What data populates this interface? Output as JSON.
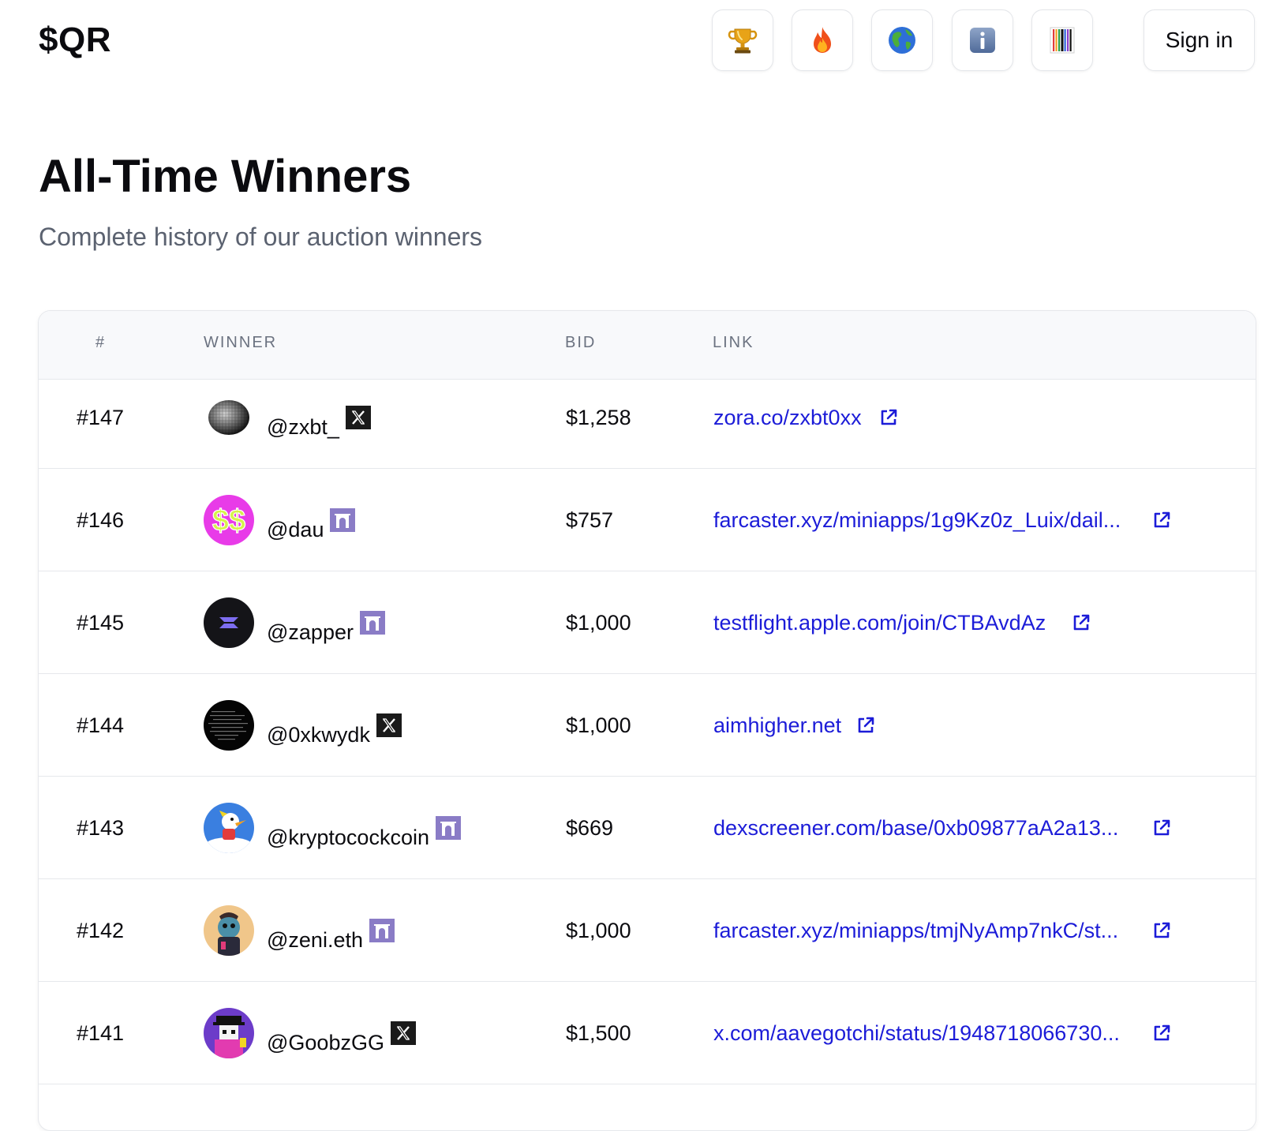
{
  "header": {
    "logo": "$QR",
    "nav_buttons": [
      {
        "name": "trophy-icon",
        "glyph": "🏆"
      },
      {
        "name": "fire-icon",
        "glyph": "🔥"
      },
      {
        "name": "globe-icon",
        "glyph": "🌎"
      },
      {
        "name": "info-icon",
        "glyph": "ℹ"
      },
      {
        "name": "barcode-icon",
        "glyph": "barcode"
      }
    ],
    "signin_label": "Sign in"
  },
  "page": {
    "title": "All-Time Winners",
    "subtitle": "Complete history of our auction winners"
  },
  "table": {
    "columns": [
      "#",
      "WINNER",
      "BID",
      "LINK"
    ],
    "rows": [
      {
        "rank": "#147",
        "winner": "@zxbt_",
        "platform": "x",
        "bid": "$1,258",
        "link": "zora.co/zxbt0xx"
      },
      {
        "rank": "#146",
        "winner": "@dau",
        "platform": "farcaster",
        "bid": "$757",
        "link": "farcaster.xyz/miniapps/1g9Kz0z_Luix/dail..."
      },
      {
        "rank": "#145",
        "winner": "@zapper",
        "platform": "farcaster",
        "bid": "$1,000",
        "link": "testflight.apple.com/join/CTBAvdAz"
      },
      {
        "rank": "#144",
        "winner": "@0xkwydk",
        "platform": "x",
        "bid": "$1,000",
        "link": "aimhigher.net"
      },
      {
        "rank": "#143",
        "winner": "@kryptocockcoin",
        "platform": "farcaster",
        "bid": "$669",
        "link": "dexscreener.com/base/0xb09877aA2a13..."
      },
      {
        "rank": "#142",
        "winner": "@zeni.eth",
        "platform": "farcaster",
        "bid": "$1,000",
        "link": "farcaster.xyz/miniapps/tmjNyAmp7nkC/st..."
      },
      {
        "rank": "#141",
        "winner": "@GoobzGG",
        "platform": "x",
        "bid": "$1,500",
        "link": "x.com/aavegotchi/status/1948718066730..."
      }
    ]
  },
  "colors": {
    "link": "#1c1cd8",
    "farcaster_badge": "#8a7cc6",
    "x_badge": "#1a1a1a",
    "border": "#e6e8ec",
    "header_bg": "#f8f9fb"
  }
}
